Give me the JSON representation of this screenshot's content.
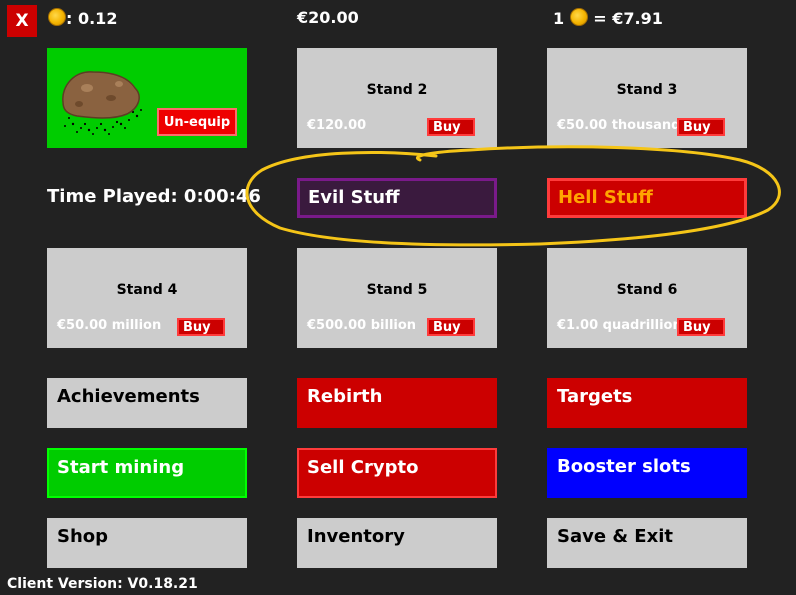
{
  "header": {
    "close_label": "X",
    "crypto_balance": ": 0.12",
    "money": "€20.00",
    "rate_prefix": "1",
    "rate_value": "= €7.91"
  },
  "equipped": {
    "unequip_label": "Un-equip"
  },
  "time_played": "Time Played: 0:00:46",
  "stands": [
    {
      "title": "Stand 2",
      "price": "€120.00",
      "buy_label": "Buy"
    },
    {
      "title": "Stand 3",
      "price": "€50.00 thousand",
      "buy_label": "Buy"
    },
    {
      "title": "Stand 4",
      "price": "€50.00 million",
      "buy_label": "Buy"
    },
    {
      "title": "Stand 5",
      "price": "€500.00 billion",
      "buy_label": "Buy"
    },
    {
      "title": "Stand 6",
      "price": "€1.00 quadrillion",
      "buy_label": "Buy"
    }
  ],
  "special": {
    "evil_label": "Evil Stuff",
    "hell_label": "Hell Stuff"
  },
  "menu": {
    "achievements": "Achievements",
    "rebirth": "Rebirth",
    "targets": "Targets",
    "start_mining": "Start mining",
    "sell_crypto": "Sell Crypto",
    "booster_slots": "Booster slots",
    "shop": "Shop",
    "inventory": "Inventory",
    "save_exit": "Save & Exit"
  },
  "footer": {
    "version": "Client Version: V0.18.21"
  },
  "colors": {
    "background": "#222222",
    "accent_red": "#cc0000",
    "accent_green": "#00cc00",
    "accent_blue": "#0000ff",
    "evil_purple": "#3a1a3e",
    "hell_text": "#ffa500",
    "annotation_yellow": "#f5c518"
  }
}
